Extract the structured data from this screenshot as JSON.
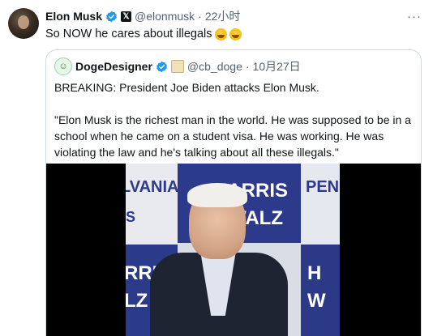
{
  "post": {
    "author_name": "Elon Musk",
    "author_handle": "@elonmusk",
    "separator": "·",
    "time": "22小时",
    "text": "So NOW he cares about illegals",
    "more_label": "···",
    "emoji_icons": [
      "rolling-on-the-floor-laughing-icon",
      "rolling-on-the-floor-laughing-icon"
    ]
  },
  "quoted": {
    "author_name": "DogeDesigner",
    "author_handle": "@cb_doge",
    "separator": "·",
    "date": "10月27日",
    "paragraphs": [
      "BREAKING: President Joe Biden attacks Elon Musk.",
      "\"Elon Musk is the richest man in the world. He was supposed to be in a school when he came on a student visa. He was working. He was violating the law and he's talking about all these illegals.\""
    ]
  },
  "video": {
    "signs": [
      "LVANIA",
      "HARRIS",
      "WALZ",
      "PEN",
      "S",
      "RRIS",
      "LZ",
      "H",
      "W"
    ]
  },
  "colors": {
    "accent": "#1d9bf0",
    "muted": "#536471",
    "text": "#0f1419",
    "border": "#cfd9de",
    "sign_blue": "#2d3a8c"
  }
}
